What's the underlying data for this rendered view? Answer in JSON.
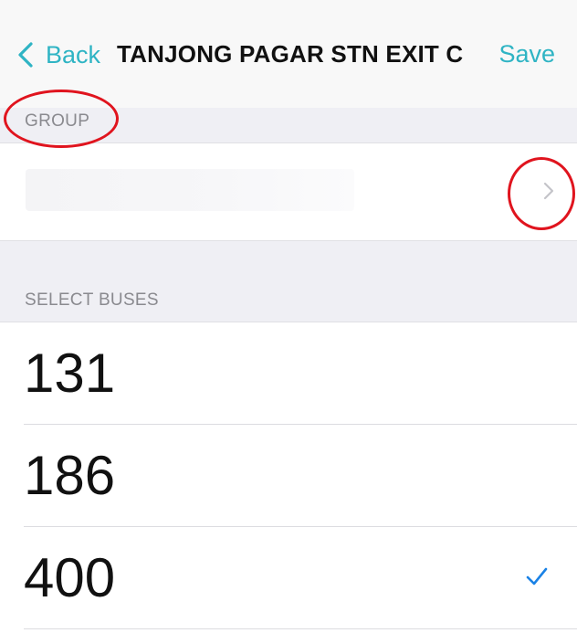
{
  "nav": {
    "back_label": "Back",
    "title": "TANJONG PAGAR STN EXIT C",
    "save_label": "Save"
  },
  "sections": {
    "group_header": "GROUP",
    "buses_header": "SELECT BUSES"
  },
  "group_row": {
    "value_redacted": true,
    "accessory": "chevron-right-icon"
  },
  "buses": [
    {
      "number": "131",
      "selected": false
    },
    {
      "number": "186",
      "selected": false
    },
    {
      "number": "400",
      "selected": true
    }
  ],
  "colors": {
    "accent": "#2fb4c4",
    "checkmark": "#1a82e6",
    "annotation": "#e0141e",
    "background": "#efeff4"
  }
}
